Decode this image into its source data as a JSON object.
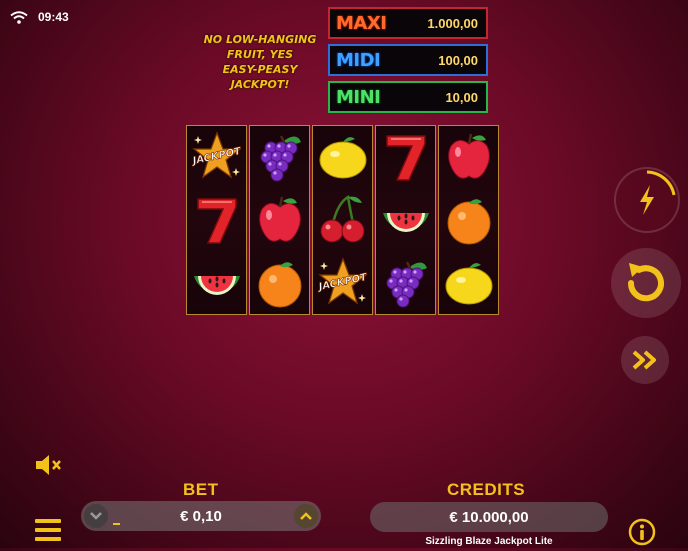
{
  "status": {
    "time": "09:43",
    "wifi_icon": "wifi-icon"
  },
  "slogan": "NO LOW-HANGING\nFRUIT, YES\nEASY-PEASY\nJACKPOT!",
  "jackpots": [
    {
      "name": "MAXI",
      "amount": "1.000,00",
      "color": "#c2272d"
    },
    {
      "name": "MIDI",
      "amount": "100,00",
      "color": "#2d6fd6"
    },
    {
      "name": "MINI",
      "amount": "10,00",
      "color": "#29b54a"
    }
  ],
  "reels": [
    [
      "jackpot-star",
      "seven",
      "watermelon"
    ],
    [
      "grapes",
      "apple",
      "orange"
    ],
    [
      "lemon",
      "cherries",
      "jackpot-star"
    ],
    [
      "seven",
      "watermelon",
      "grapes"
    ],
    [
      "apple",
      "orange",
      "lemon"
    ]
  ],
  "jackpot_symbol_text": "JACKPOT",
  "controls": {
    "turbo_icon": "lightning-icon",
    "spin_icon": "spin-arrow-icon",
    "autoplay_icon": "fast-forward-icon",
    "sound_icon": "speaker-muted-icon",
    "menu_icon": "hamburger-menu-icon",
    "info_icon": "info-icon"
  },
  "bet": {
    "label": "BET",
    "value": "€ 0,10"
  },
  "credits": {
    "label": "CREDITS",
    "value": "€ 10.000,00"
  },
  "game_title": "Sizzling Blaze Jackpot Lite",
  "colors": {
    "gold": "#f3c21a",
    "background": "#6a0a26"
  }
}
